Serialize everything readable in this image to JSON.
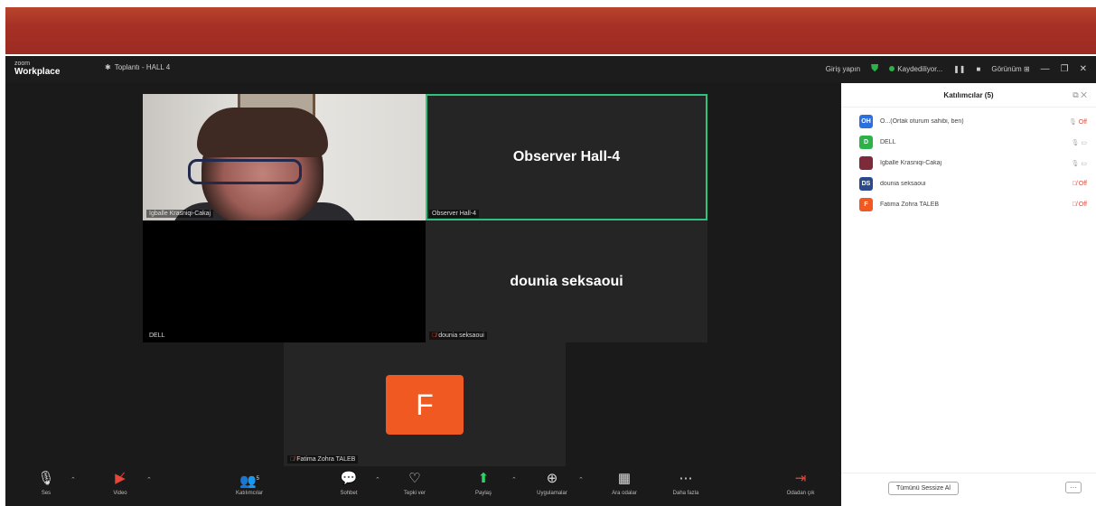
{
  "app": {
    "brand_top": "zoom",
    "brand_bottom": "Workplace",
    "meeting_title": "Toplantı - HALL 4",
    "signin": "Giriş yapın",
    "recording": "Kaydediliyor...",
    "view": "Görünüm"
  },
  "tiles": {
    "gzale": {
      "name": "Igballe Krasniqi-Cakaj"
    },
    "observer": {
      "big": "Observer Hall-4",
      "name": "Observer Hall-4"
    },
    "dell": {
      "name": "DELL"
    },
    "dounia": {
      "big": "dounia seksaoui",
      "name": "dounia seksaoui"
    },
    "fatima": {
      "initial": "F",
      "name": "Fatima Zohra TALEB",
      "color": "#f05a22"
    }
  },
  "toolbar": {
    "items": [
      {
        "label": "Ses",
        "icon": "microphone-icon"
      },
      {
        "label": "Video",
        "icon": "video-off-icon"
      },
      {
        "label": "Katılımcılar",
        "icon": "participants-icon",
        "count": "5"
      },
      {
        "label": "Sohbet",
        "icon": "chat-icon"
      },
      {
        "label": "Tepki ver",
        "icon": "heart-icon"
      },
      {
        "label": "Paylaş",
        "icon": "share-icon"
      },
      {
        "label": "Uygulamalar",
        "icon": "apps-icon"
      },
      {
        "label": "Ara odalar",
        "icon": "breakout-rooms-icon"
      },
      {
        "label": "Daha fazla",
        "icon": "more-icon"
      },
      {
        "label": "Odadan çık",
        "icon": "leave-icon"
      }
    ]
  },
  "panel": {
    "title": "Katılımcılar (5)",
    "participants": [
      {
        "initials": "OH",
        "name": "O...(Ortak oturum sahibi, ben)",
        "status": "Off",
        "color": "#2d6fdc"
      },
      {
        "initials": "D",
        "name": "DELL",
        "status": "",
        "color": "#2bb34a"
      },
      {
        "initials": "",
        "name": "Igballe Krasniqi-Cakaj",
        "status": "",
        "color": "#7d2a3a"
      },
      {
        "initials": "DS",
        "name": "dounia seksaoui",
        "status": "Off",
        "color": "#2b4a8c"
      },
      {
        "initials": "F",
        "name": "Fatima Zohra TALEB",
        "status": "Off",
        "color": "#f05a22"
      }
    ],
    "mute_all": "Tümünü Sessize Al",
    "more": "···"
  }
}
